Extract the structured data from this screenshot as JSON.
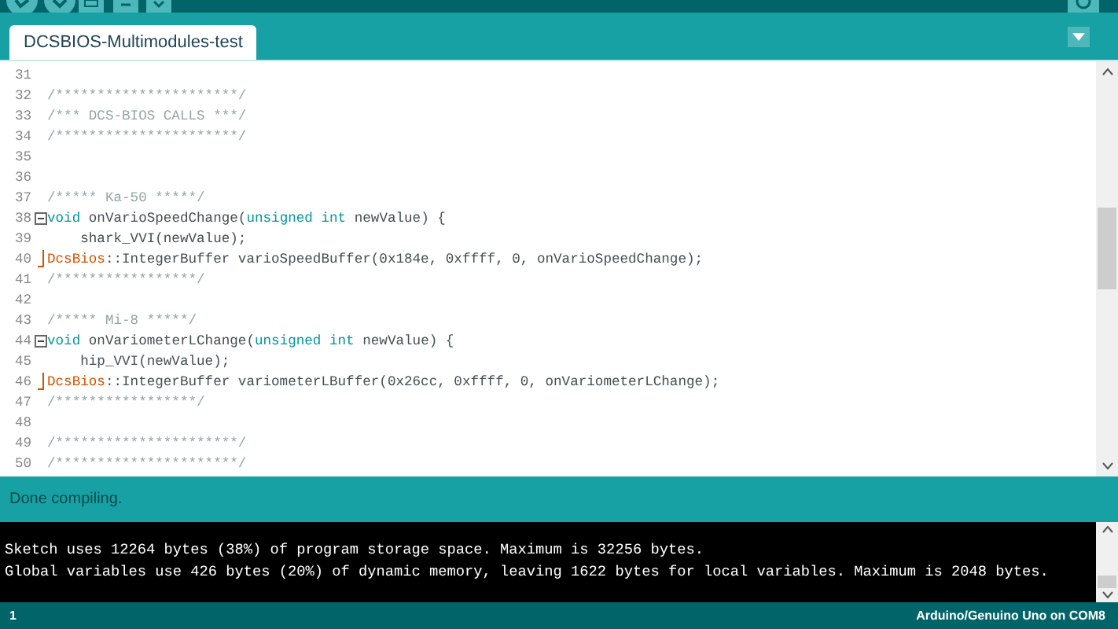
{
  "tabs": [
    {
      "label": "DCSBIOS-Multimodules-test",
      "selected": true
    }
  ],
  "editor": {
    "lines": [
      {
        "number": "31"
      },
      {
        "number": "32",
        "segments": [
          {
            "kind": "comment",
            "text": "/**********************/"
          }
        ]
      },
      {
        "number": "33",
        "segments": [
          {
            "kind": "comment",
            "text": "/*** DCS-BIOS CALLS ***/"
          }
        ]
      },
      {
        "number": "34",
        "segments": [
          {
            "kind": "comment",
            "text": "/**********************/"
          }
        ]
      },
      {
        "number": "35"
      },
      {
        "number": "36"
      },
      {
        "number": "37",
        "segments": [
          {
            "kind": "comment",
            "text": "/***** Ka-50 *****/"
          }
        ]
      },
      {
        "number": "38",
        "kind": "blockstart",
        "segments": [
          {
            "kind": "keyword",
            "text": "void"
          },
          {
            "kind": "plain",
            "text": " onVarioSpeedChange("
          },
          {
            "kind": "keyword",
            "text": "unsigned int"
          },
          {
            "kind": "plain",
            "text": " newValue) {"
          }
        ]
      },
      {
        "number": "39",
        "segments": [
          {
            "kind": "plain",
            "text": "    shark_VVI(newValue);"
          }
        ]
      },
      {
        "number": "40",
        "kind": "blockend",
        "segments": [
          {
            "kind": "class",
            "text": "DcsBios"
          },
          {
            "kind": "plain",
            "text": "::IntegerBuffer varioSpeedBuffer(0x184e, 0xffff, 0, onVarioSpeedChange);"
          }
        ]
      },
      {
        "number": "41",
        "segments": [
          {
            "kind": "comment",
            "text": "/*****************/"
          }
        ]
      },
      {
        "number": "42"
      },
      {
        "number": "43",
        "segments": [
          {
            "kind": "comment",
            "text": "/***** Mi-8 *****/"
          }
        ]
      },
      {
        "number": "44",
        "kind": "blockstart",
        "segments": [
          {
            "kind": "keyword",
            "text": "void"
          },
          {
            "kind": "plain",
            "text": " onVariometerLChange("
          },
          {
            "kind": "keyword",
            "text": "unsigned int"
          },
          {
            "kind": "plain",
            "text": " newValue) {"
          }
        ]
      },
      {
        "number": "45",
        "segments": [
          {
            "kind": "plain",
            "text": "    hip_VVI(newValue);"
          }
        ]
      },
      {
        "number": "46",
        "kind": "blockend",
        "segments": [
          {
            "kind": "class",
            "text": "DcsBios"
          },
          {
            "kind": "plain",
            "text": "::IntegerBuffer variometerLBuffer(0x26cc, 0xffff, 0, onVariometerLChange);"
          }
        ]
      },
      {
        "number": "47",
        "segments": [
          {
            "kind": "comment",
            "text": "/*****************/"
          }
        ]
      },
      {
        "number": "48"
      },
      {
        "number": "49",
        "segments": [
          {
            "kind": "comment",
            "text": "/**********************/"
          }
        ]
      },
      {
        "number": "50",
        "segments": [
          {
            "kind": "comment",
            "text": "/**********************/"
          }
        ]
      }
    ]
  },
  "status": "Done compiling.",
  "console": [
    "Sketch uses 12264 bytes (38%) of program storage space. Maximum is 32256 bytes.",
    "Global variables use 426 bytes (20%) of dynamic memory, leaving 1622 bytes for local variables. Maximum is 2048 bytes."
  ],
  "footer": {
    "line": "1",
    "board": "Arduino/Genuino Uno on COM8"
  }
}
